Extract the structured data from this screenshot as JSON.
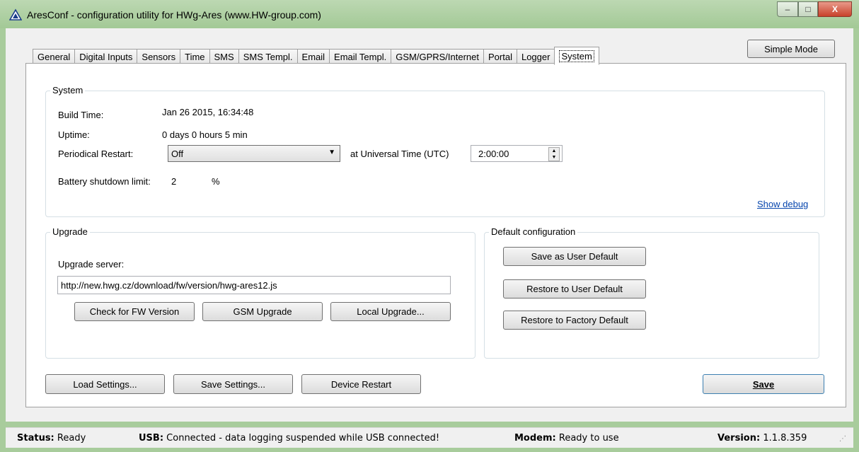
{
  "window": {
    "title": "AresConf - configuration utility for HWg-Ares (www.HW-group.com)",
    "controls": {
      "minimize": "–",
      "maximize": "□",
      "close": "X"
    }
  },
  "tabs": [
    "General",
    "Digital Inputs",
    "Sensors",
    "Time",
    "SMS",
    "SMS Templ.",
    "Email",
    "Email Templ.",
    "GSM/GPRS/Internet",
    "Portal",
    "Logger",
    "System"
  ],
  "active_tab": "System",
  "simple_mode_label": "Simple Mode",
  "system": {
    "group_label": "System",
    "build_time_label": "Build Time:",
    "build_time_value": "Jan 26 2015, 16:34:48",
    "uptime_label": "Uptime:",
    "uptime_value": "0 days 0 hours 5 min",
    "restart_label": "Periodical Restart:",
    "restart_value": "Off",
    "utc_label": "at Universal Time (UTC)",
    "utc_value": "2:00:00",
    "battery_label": "Battery shutdown limit:",
    "battery_value": "2",
    "battery_unit": "%",
    "show_debug": "Show debug"
  },
  "upgrade": {
    "group_label": "Upgrade",
    "server_label": "Upgrade server:",
    "server_value": "http://new.hwg.cz/download/fw/version/hwg-ares12.js",
    "check_btn": "Check for FW Version",
    "gsm_btn": "GSM Upgrade",
    "local_btn": "Local Upgrade..."
  },
  "default_config": {
    "group_label": "Default configuration",
    "save_user": "Save as User Default",
    "restore_user": "Restore to User Default",
    "restore_factory": "Restore to Factory Default"
  },
  "bottom": {
    "load": "Load Settings...",
    "save_settings": "Save Settings...",
    "restart": "Device Restart",
    "save": "Save"
  },
  "status": {
    "status_label": "Status:",
    "status_value": "Ready",
    "usb_label": "USB:",
    "usb_value": "Connected - data logging suspended while USB connected!",
    "modem_label": "Modem:",
    "modem_value": "Ready to use",
    "version_label": "Version:",
    "version_value": "1.1.8.359"
  }
}
